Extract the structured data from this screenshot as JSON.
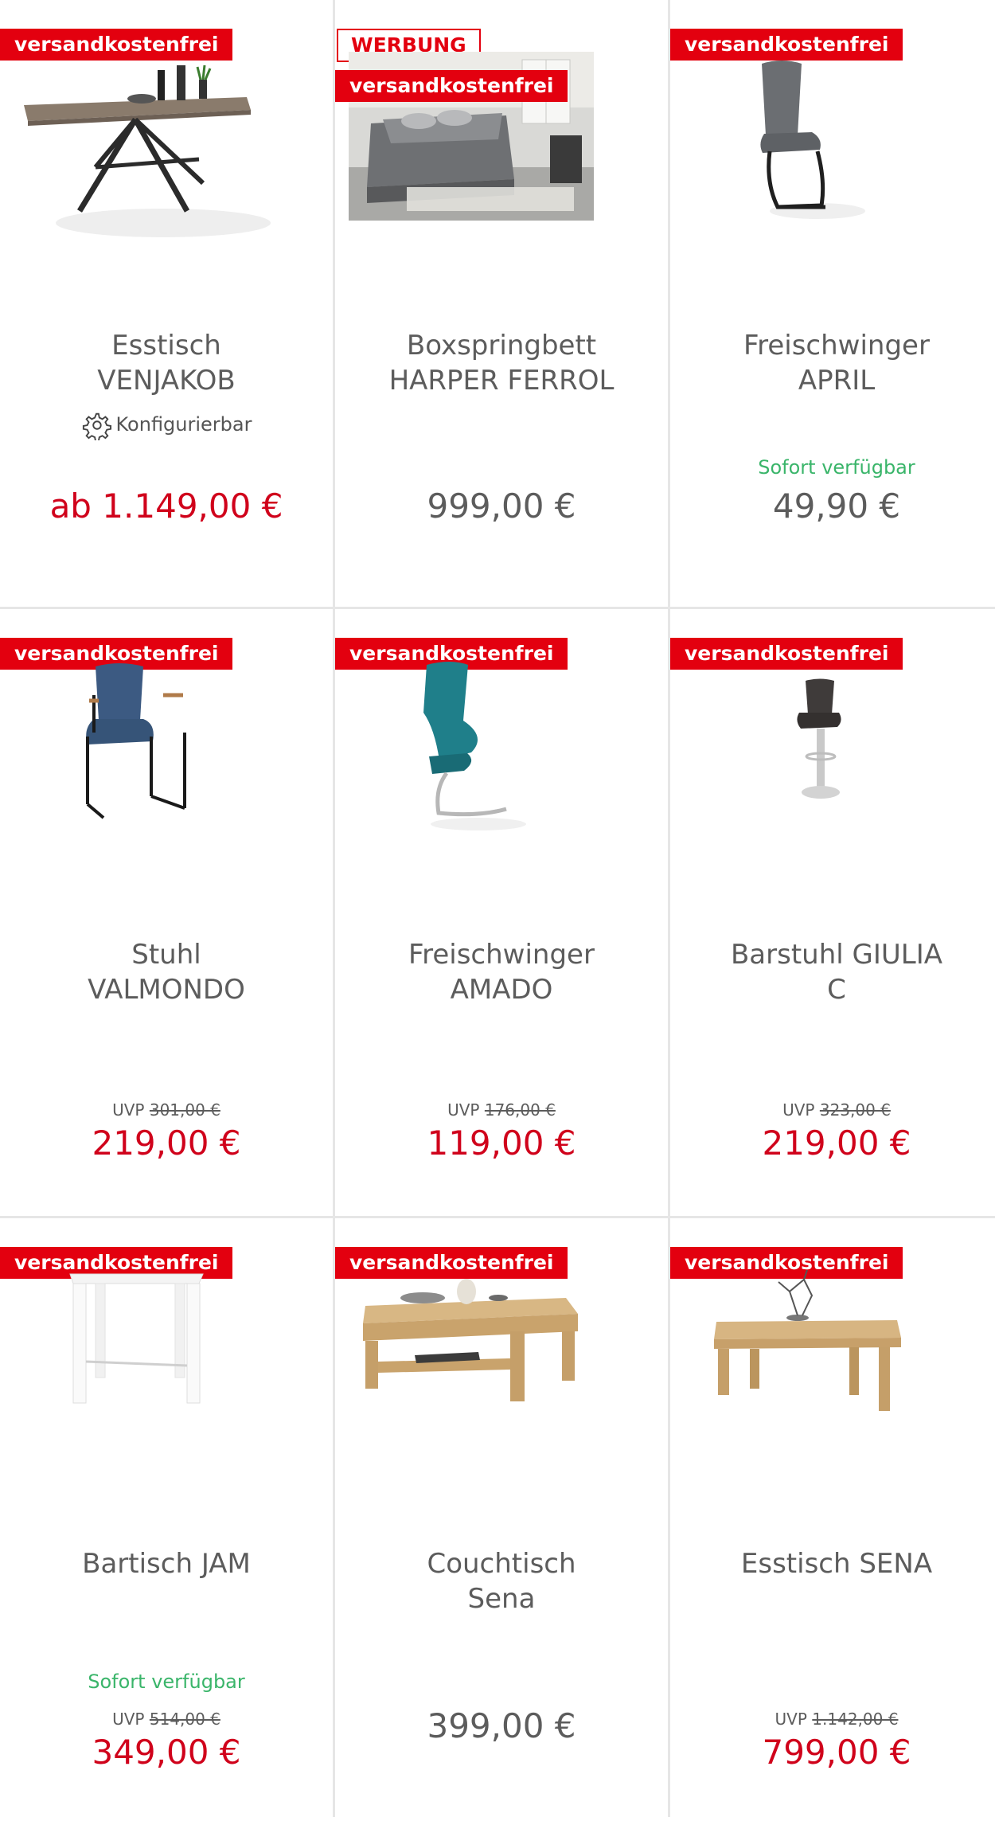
{
  "badges": {
    "shipping": "versandkostenfrei",
    "ad": "WERBUNG"
  },
  "colors": {
    "accent": "#e3000f",
    "price_red": "#d0021b",
    "available_green": "#3ab56a",
    "text_gray": "#5c5c5c"
  },
  "products": [
    {
      "name_line1": "Esstisch",
      "name_line2": "VENJAKOB",
      "configurable_label": "Konfigurierbar",
      "configurable_icon": "gear-icon",
      "price": "ab 1.149,00 €"
    },
    {
      "name_line1": "Boxspringbett",
      "name_line2": "HARPER FERROL",
      "price": "999,00 €"
    },
    {
      "name_line1": "Freischwinger",
      "name_line2": "APRIL",
      "availability": "Sofort verfügbar",
      "price": "49,90 €"
    },
    {
      "name_line1": "Stuhl",
      "name_line2": "VALMONDO",
      "uvp_label": "UVP",
      "uvp_value": "301,00 €",
      "price": "219,00 €"
    },
    {
      "name_line1": "Freischwinger",
      "name_line2": "AMADO",
      "uvp_label": "UVP",
      "uvp_value": "176,00 €",
      "price": "119,00 €"
    },
    {
      "name_line1": "Barstuhl GIULIA",
      "name_line2": "C",
      "uvp_label": "UVP",
      "uvp_value": "323,00 €",
      "price": "219,00 €"
    },
    {
      "name_line1": "Bartisch JAM",
      "availability": "Sofort verfügbar",
      "uvp_label": "UVP",
      "uvp_value": "514,00 €",
      "price": "349,00 €"
    },
    {
      "name_line1": "Couchtisch",
      "name_line2": "Sena",
      "price": "399,00 €"
    },
    {
      "name_line1": "Esstisch SENA",
      "uvp_label": "UVP",
      "uvp_value": "1.142,00 €",
      "price": "799,00 €"
    }
  ]
}
